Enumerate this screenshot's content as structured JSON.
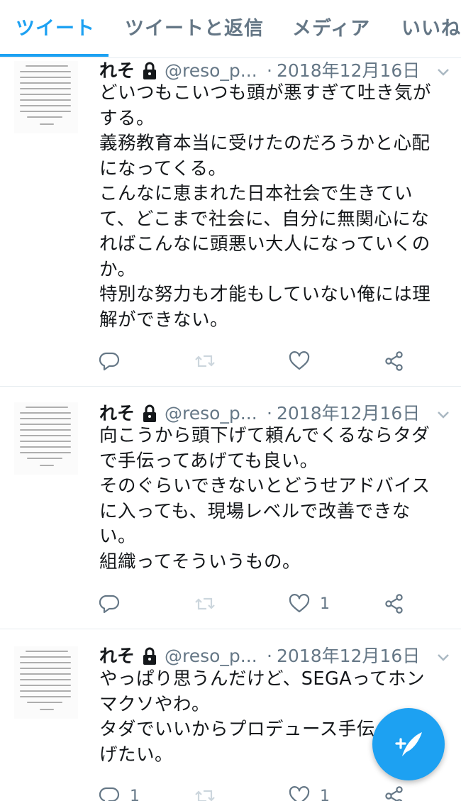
{
  "tabs": [
    "ツイート",
    "ツイートと返信",
    "メディア",
    "いいね"
  ],
  "tweets": [
    {
      "name": "れそ",
      "handle": "@reso_p...",
      "dot": "·",
      "date": "2018年12月16日",
      "text": "どいつもこいつも頭が悪すぎて吐き気が\nする。\n義務教育本当に受けたのだろうかと心配\nになってくる。\nこんなに恵まれた日本社会で生きてい\nて、どこまで社会に、自分に無関心にな\nればこんなに頭悪い大人になっていくの\nか。\n特別な努力も才能もしていない俺には理\n解ができない。",
      "reply_count": "",
      "retweet_count": "",
      "like_count": ""
    },
    {
      "name": "れそ",
      "handle": "@reso_p...",
      "dot": "·",
      "date": "2018年12月16日",
      "text": "向こうから頭下げて頼んでくるならタダ\nで手伝ってあげても良い。\nそのぐらいできないとどうせアドバイス\nに入っても、現場レベルで改善できな\nい。\n組織ってそういうもの。",
      "reply_count": "",
      "retweet_count": "",
      "like_count": "1"
    },
    {
      "name": "れそ",
      "handle": "@reso_p...",
      "dot": "·",
      "date": "2018年12月16日",
      "text": "やっぱり思うんだけど、SEGAってホン\nマクソやわ。\nタダでいいからプロデュース手伝ってあ\nげたい。",
      "reply_count": "1",
      "retweet_count": "",
      "like_count": "1"
    }
  ],
  "colors": {
    "accent": "#1da1f2",
    "secondary_text": "#657786",
    "primary_text": "#14171a",
    "divider": "#e6ecf0"
  },
  "icons": {
    "lock": "lock-icon",
    "caret": "chevron-down-icon",
    "reply": "reply-icon",
    "retweet": "retweet-icon",
    "like": "heart-icon",
    "share": "share-icon",
    "compose": "compose-tweet-icon"
  }
}
